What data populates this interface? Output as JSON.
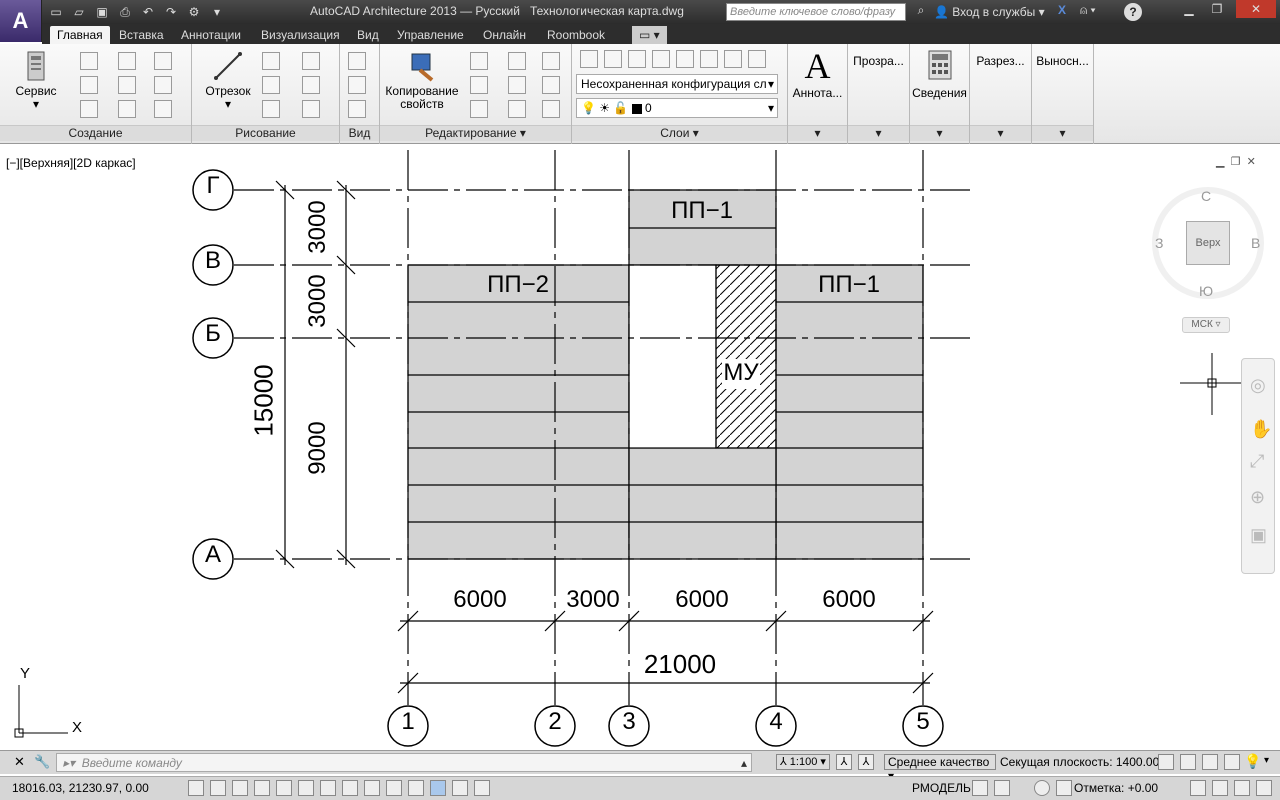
{
  "title_bar": {
    "app_title": "AutoCAD Architecture 2013 — Русский",
    "file_name": "Технологическая карта.dwg",
    "search_placeholder": "Введите ключевое слово/фразу",
    "login_label": "Вход в службы",
    "help_label": "?"
  },
  "tabs": [
    "Главная",
    "Вставка",
    "Аннотации",
    "Визуализация",
    "Вид",
    "Управление",
    "Онлайн",
    "Roombook"
  ],
  "active_tab": "Главная",
  "ribbon": {
    "panels": {
      "create": "Создание",
      "draw": "Рисование",
      "view": "Вид",
      "edit": "Редактирование",
      "layers": "Слои"
    },
    "service_label": "Сервис",
    "line_label": "Отрезок",
    "copy_props_label": "Копирование свойств",
    "layer_config": "Несохраненная конфигурация сл",
    "layer_current": "0",
    "annotation_label": "Аннота...",
    "transparency_label": "Прозра...",
    "info_label": "Сведения",
    "section_label": "Разрез...",
    "callout_label": "Выносн..."
  },
  "viewport": {
    "label": "[−][Верхняя][2D каркас]",
    "viewcube": {
      "top": "Верх",
      "north": "С",
      "south": "Ю",
      "west": "З",
      "east": "В",
      "ucs": "МСК"
    }
  },
  "drawing": {
    "row_axes": [
      "Г",
      "В",
      "Б",
      "А"
    ],
    "col_axes": [
      "1",
      "2",
      "3",
      "4",
      "5"
    ],
    "dims_horizontal": [
      "6000",
      "3000",
      "6000",
      "6000"
    ],
    "dim_total": "21000",
    "dims_vertical": [
      "3000",
      "3000",
      "9000"
    ],
    "dim_vertical_total": "15000",
    "slab_labels": [
      "ПП−2",
      "ПП−1",
      "ПП−1"
    ],
    "monolith_label": "МУ",
    "ucs_x": "X",
    "ucs_y": "Y"
  },
  "command": {
    "placeholder": "Введите команду"
  },
  "status": {
    "coords": "18016.03, 21230.97, 0.00",
    "model": "РМОДЕЛЬ",
    "scale": "1:100",
    "quality": "Среднее качество",
    "cut_plane": "Секущая плоскость:  1400.00",
    "elevation": "Отметка:  +0.00"
  },
  "colors": {
    "slab_fill": "#d3d3d3",
    "accent_tab": "#f4f4f4",
    "title_bg": "#2c2c2c"
  }
}
